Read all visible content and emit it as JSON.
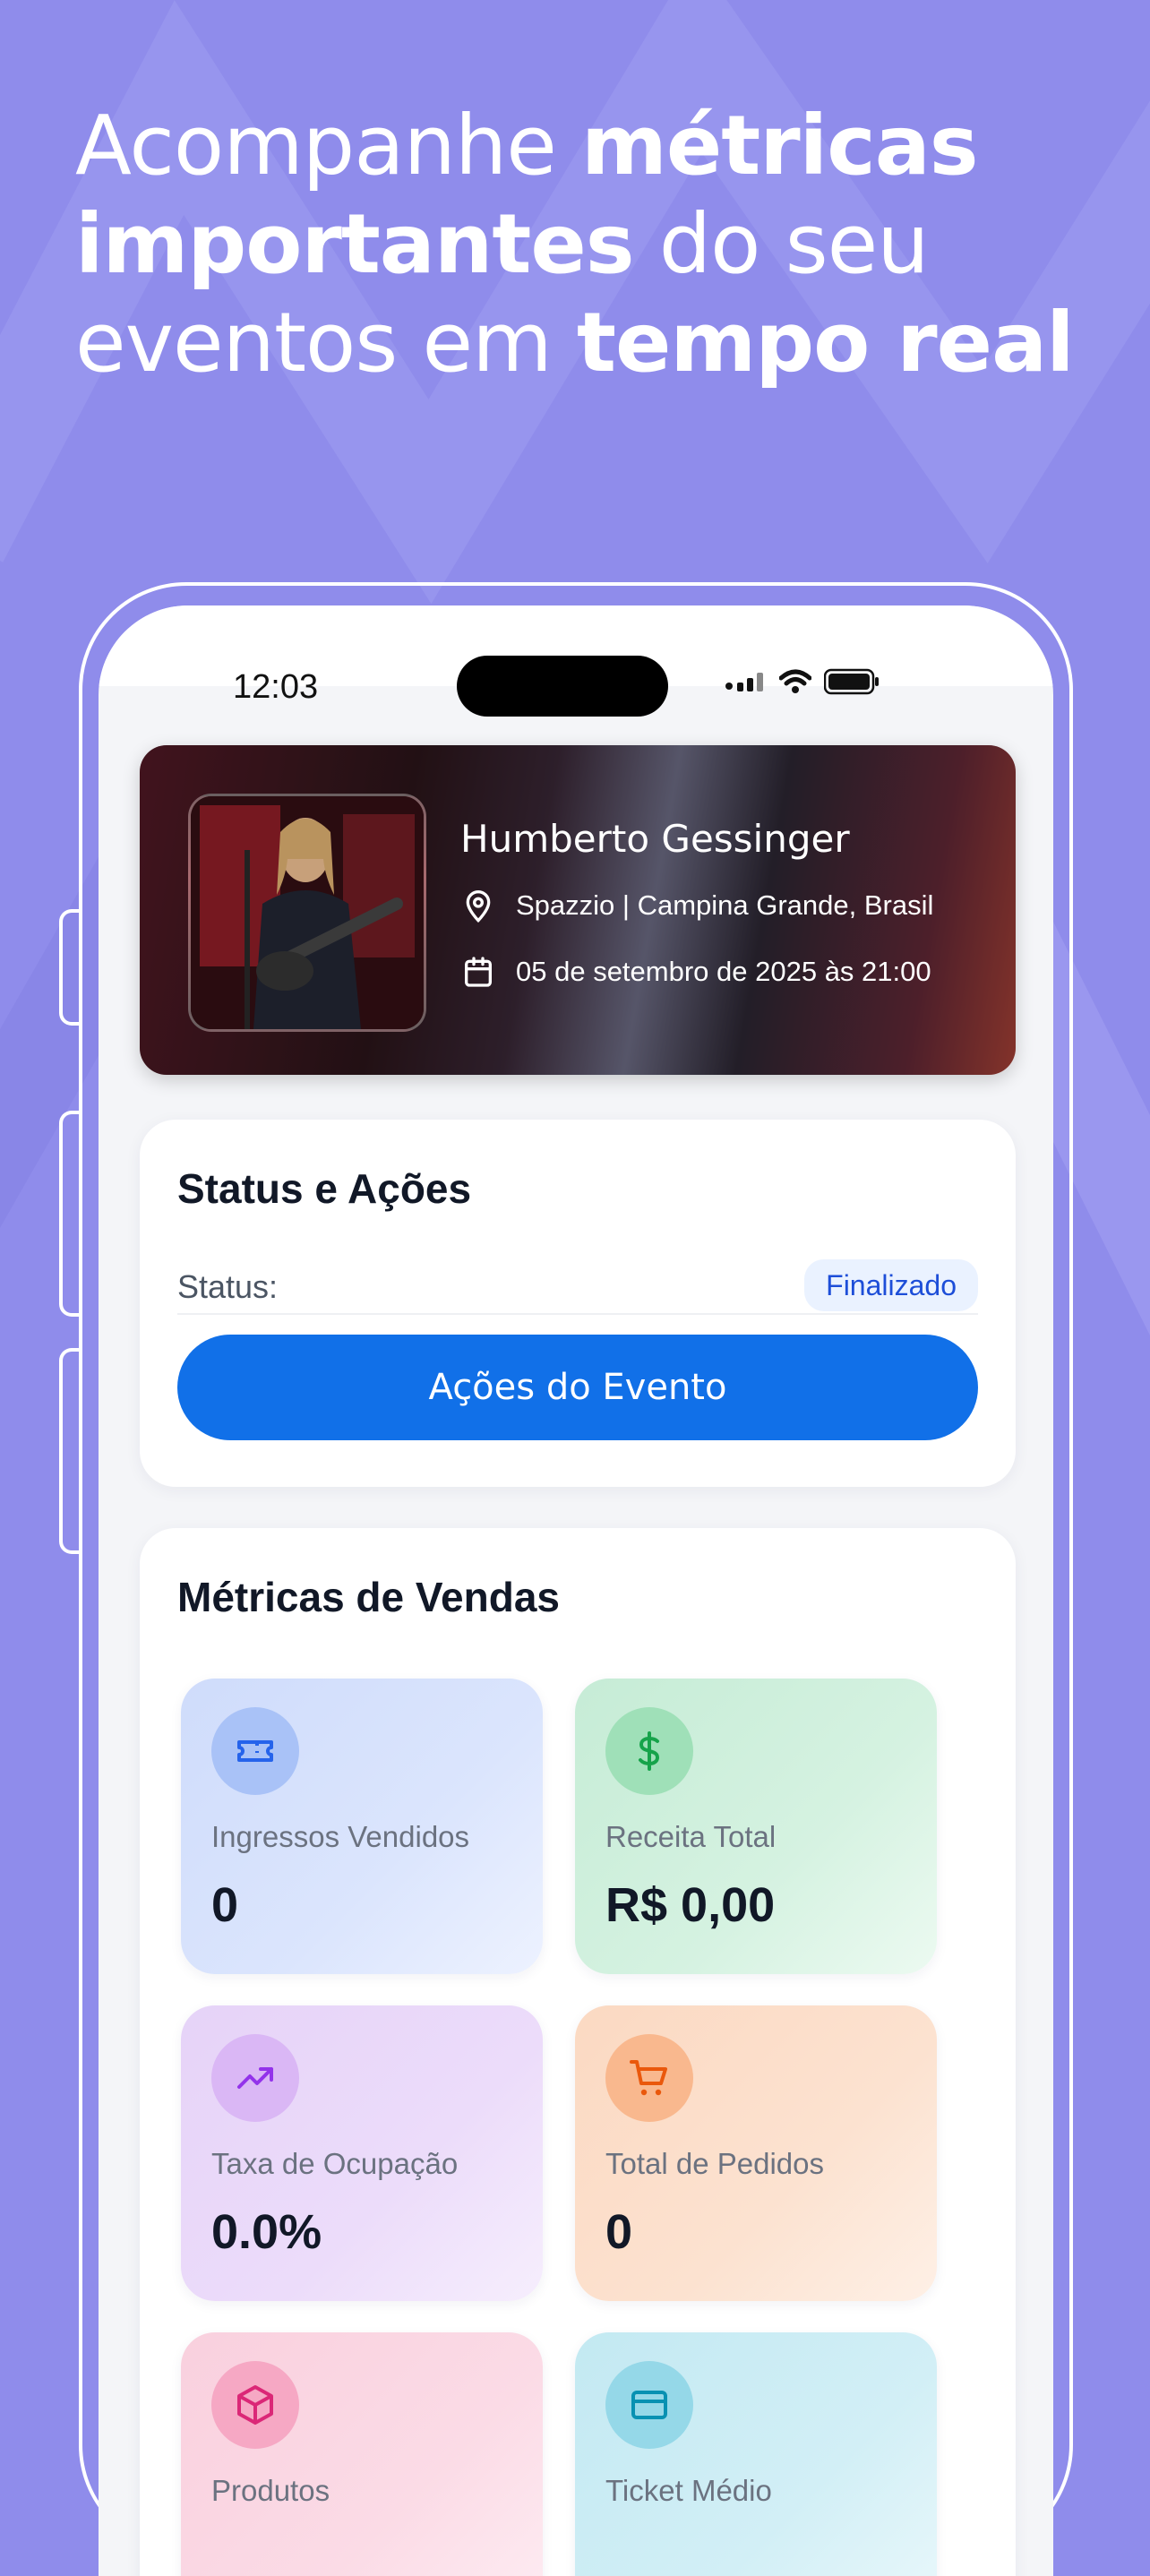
{
  "headline": {
    "part1": "Acompanhe ",
    "bold1": "métricas importantes",
    "part2": " do seu eventos em ",
    "bold2": "tempo real"
  },
  "status_bar": {
    "time": "12:03"
  },
  "event": {
    "name": "Humberto Gessinger",
    "location": "Spazzio | Campina Grande, Brasil",
    "date": "05 de setembro de 2025 às 21:00"
  },
  "status_section": {
    "title": "Status e Ações",
    "status_label": "Status:",
    "status_value": "Finalizado",
    "action_button": "Ações do Evento"
  },
  "metrics_section": {
    "title": "Métricas de Vendas",
    "items": [
      {
        "label": "Ingressos Vendidos",
        "value": "0",
        "icon": "ticket-icon"
      },
      {
        "label": "Receita Total",
        "value": "R$ 0,00",
        "icon": "dollar-icon"
      },
      {
        "label": "Taxa de Ocupação",
        "value": "0.0%",
        "icon": "trending-up-icon"
      },
      {
        "label": "Total de Pedidos",
        "value": "0",
        "icon": "cart-icon"
      },
      {
        "label": "Produtos",
        "value": "",
        "icon": "package-icon"
      },
      {
        "label": "Ticket Médio",
        "value": "",
        "icon": "credit-card-icon"
      }
    ]
  },
  "colors": {
    "background": "#8f8ceb",
    "primary_button": "#1170e8",
    "badge_text": "#1d4ed8",
    "badge_bg": "#eaf2ff"
  }
}
